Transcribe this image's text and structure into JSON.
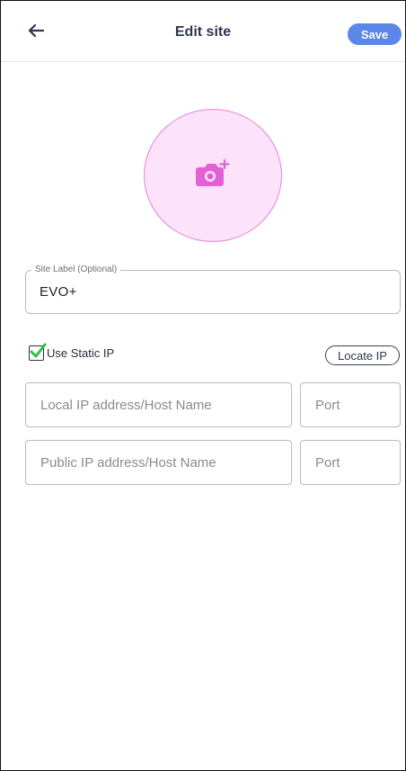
{
  "header": {
    "title": "Edit site",
    "save_label": "Save",
    "back_icon": "arrow-left-icon"
  },
  "avatar": {
    "icon": "camera-add-icon",
    "accent_color": "#e582da",
    "fill_color": "#fde3f9"
  },
  "site_label": {
    "floating_label": "Site Label (Optional)",
    "value": "EVO+"
  },
  "static_ip": {
    "label": "Use Static IP",
    "checked": true,
    "locate_label": "Locate IP"
  },
  "fields": {
    "local_ip_placeholder": "Local IP address/Host Name",
    "local_port_placeholder": "Port",
    "public_ip_placeholder": "Public IP address/Host Name",
    "public_port_placeholder": "Port"
  },
  "colors": {
    "save_button": "#5a87e8",
    "check_mark": "#2fbf4a"
  }
}
